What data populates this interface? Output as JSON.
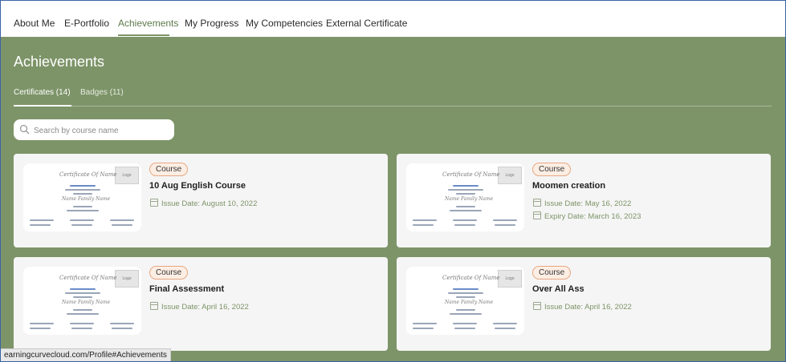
{
  "nav": {
    "items": [
      {
        "label": "About Me"
      },
      {
        "label": "E-Portfolio"
      },
      {
        "label": "Achievements",
        "active": true
      },
      {
        "label": "My Progress"
      },
      {
        "label": "My Competencies"
      },
      {
        "label": "External Certificate"
      }
    ]
  },
  "page": {
    "title": "Achievements",
    "tabs": [
      {
        "label": "Certificates (14)",
        "active": true
      },
      {
        "label": "Badges (11)"
      }
    ]
  },
  "search": {
    "placeholder": "Search by course name",
    "value": ""
  },
  "cards": [
    {
      "badge": "Course",
      "title": "10 Aug English Course",
      "dates": [
        "Issue Date: August 10, 2022"
      ]
    },
    {
      "badge": "Course",
      "title": "Moomen creation",
      "dates": [
        "Issue Date: May 16, 2022",
        "Expiry Date: March 16, 2023"
      ]
    },
    {
      "badge": "Course",
      "title": "Final Assessment",
      "dates": [
        "Issue Date: April 16, 2022"
      ]
    },
    {
      "badge": "Course",
      "title": "Over All Ass",
      "dates": [
        "Issue Date: April 16, 2022"
      ]
    }
  ],
  "thumbnail": {
    "heading": "Certificate Of Name",
    "name": "Name Family Name",
    "logo": "Logo"
  },
  "status_bar": {
    "url": "earningcurvecloud.com/Profile#Achievements"
  },
  "colors": {
    "accent": "#7d9468",
    "badge_border": "#e7a882",
    "badge_bg": "#fdeee4"
  },
  "icons": {
    "search": "search-icon",
    "date": "calendar-icon"
  }
}
